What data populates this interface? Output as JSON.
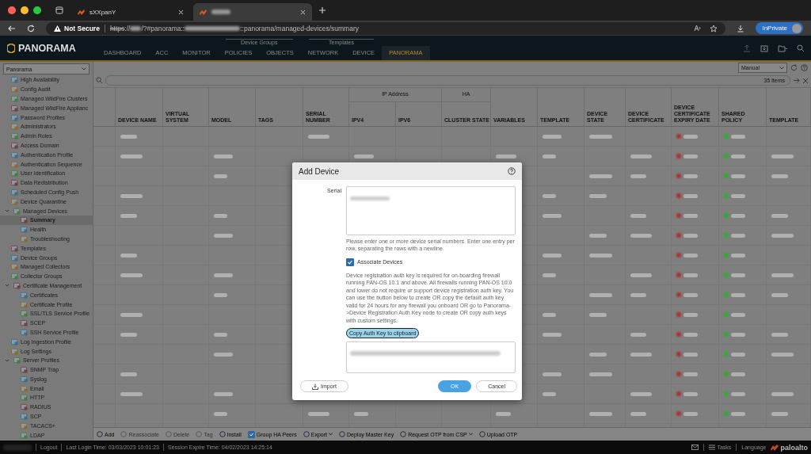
{
  "browser": {
    "tabs": [
      {
        "title": "sXXpanY",
        "selected": false
      },
      {
        "selected": true
      }
    ],
    "address": {
      "security": "Not Secure",
      "scheme": "https",
      "url_parts": [
        "://",
        "/?#panorama::",
        "::panorama/managed-devices/summary"
      ]
    },
    "profile": "InPrivate"
  },
  "app_header": {
    "logo": "PANORAMA",
    "nav": [
      {
        "items": [
          {
            "label": "DASHBOARD",
            "selected": false
          },
          {
            "label": "ACC",
            "selected": false
          },
          {
            "label": "MONITOR",
            "selected": false
          }
        ]
      },
      {
        "group": "Device Groups",
        "items": [
          {
            "label": "POLICIES",
            "selected": false
          },
          {
            "label": "OBJECTS",
            "selected": false
          }
        ]
      },
      {
        "group": "Templates",
        "items": [
          {
            "label": "NETWORK",
            "selected": false
          },
          {
            "label": "DEVICE",
            "selected": false
          }
        ]
      },
      {
        "items": [
          {
            "label": "PANORAMA",
            "selected": true
          }
        ]
      }
    ]
  },
  "sidebar": {
    "context": "Panorama",
    "items": [
      {
        "label": "High Availability",
        "selected": false
      },
      {
        "label": "Config Audit",
        "selected": false
      },
      {
        "label": "Managed WildFire Clusters",
        "selected": false
      },
      {
        "label": "Managed WildFire Applianc",
        "selected": false
      },
      {
        "label": "Password Profiles",
        "selected": false
      },
      {
        "label": "Administrators",
        "selected": false
      },
      {
        "label": "Admin Roles",
        "selected": false
      },
      {
        "label": "Access Domain",
        "selected": false
      },
      {
        "label": "Authentication Profile",
        "selected": false
      },
      {
        "label": "Authentication Sequence",
        "selected": false
      },
      {
        "label": "User Identification",
        "selected": false
      },
      {
        "label": "Data Redistribution",
        "selected": false
      },
      {
        "label": "Scheduled Config Push",
        "selected": false
      },
      {
        "label": "Device Quarantine",
        "selected": false
      },
      {
        "label": "Managed Devices",
        "selected": false,
        "expanded": true,
        "children": [
          {
            "label": "Summary",
            "selected": true
          },
          {
            "label": "Health",
            "selected": false
          },
          {
            "label": "Troubleshooting",
            "selected": false
          }
        ]
      },
      {
        "label": "Templates",
        "selected": false
      },
      {
        "label": "Device Groups",
        "selected": false
      },
      {
        "label": "Managed Collectors",
        "selected": false
      },
      {
        "label": "Collector Groups",
        "selected": false
      },
      {
        "label": "Certificate Management",
        "selected": false,
        "expanded": true,
        "children": [
          {
            "label": "Certificates",
            "selected": false
          },
          {
            "label": "Certificate Profile",
            "selected": false
          },
          {
            "label": "SSL/TLS Service Profile",
            "selected": false
          },
          {
            "label": "SCEP",
            "selected": false
          },
          {
            "label": "SSH Service Profile",
            "selected": false
          }
        ]
      },
      {
        "label": "Log Ingestion Profile",
        "selected": false
      },
      {
        "label": "Log Settings",
        "selected": false
      },
      {
        "label": "Server Profiles",
        "selected": false,
        "expanded": true,
        "children": [
          {
            "label": "SNMP Trap",
            "selected": false
          },
          {
            "label": "Syslog",
            "selected": false
          },
          {
            "label": "Email",
            "selected": false
          },
          {
            "label": "HTTP",
            "selected": false
          },
          {
            "label": "RADIUS",
            "selected": false
          },
          {
            "label": "SCP",
            "selected": false
          },
          {
            "label": "TACACS+",
            "selected": false
          },
          {
            "label": "LDAP",
            "selected": false
          }
        ]
      }
    ]
  },
  "toolbar": {
    "refresh_mode": "Manual",
    "item_count": "35 items"
  },
  "table": {
    "columns": [
      {
        "label": "DEVICE NAME"
      },
      {
        "label": "VIRTUAL SYSTEM"
      },
      {
        "label": "MODEL"
      },
      {
        "label": "TAGS"
      },
      {
        "label": "SERIAL NUMBER"
      },
      {
        "group": "IP Address",
        "children": [
          {
            "label": "IPV4"
          },
          {
            "label": "IPV6"
          }
        ]
      },
      {
        "group": "HA",
        "children": [
          {
            "label": "CLUSTER STATE"
          }
        ]
      },
      {
        "label": "VARIABLES"
      },
      {
        "label": "TEMPLATE"
      },
      {
        "label": "DEVICE STATE"
      },
      {
        "label": "DEVICE CERTIFICATE"
      },
      {
        "label": "DEVICE CERTIFICATE EXPIRY DATE"
      },
      {
        "label": "SHARED POLICY"
      },
      {
        "label": "TEMPLATE"
      }
    ]
  },
  "actions": [
    {
      "kind": "button",
      "label": "Add",
      "disabled": false,
      "dropdown": false
    },
    {
      "kind": "button",
      "label": "Reassociate",
      "disabled": true,
      "dropdown": false
    },
    {
      "kind": "button",
      "label": "Delete",
      "disabled": true,
      "dropdown": false
    },
    {
      "kind": "button",
      "label": "Tag",
      "disabled": true,
      "dropdown": false
    },
    {
      "kind": "button",
      "label": "Install",
      "disabled": false,
      "dropdown": false
    },
    {
      "kind": "checkbox",
      "label": "Group HA Peers",
      "checked": true
    },
    {
      "kind": "button",
      "label": "Export",
      "disabled": false,
      "dropdown": true
    },
    {
      "kind": "button",
      "label": "Deploy Master Key",
      "disabled": false,
      "dropdown": false
    },
    {
      "kind": "button",
      "label": "Request OTP from CSP",
      "disabled": false,
      "dropdown": true
    },
    {
      "kind": "button",
      "label": "Upload OTP",
      "disabled": false,
      "dropdown": false
    }
  ],
  "status_bar": {
    "logout": "Logout",
    "last_login": "Last Login Time: 03/03/2023 10:01:23",
    "session_expire": "Session Expire Time: 04/02/2023 14:25:14",
    "tasks": "Tasks",
    "language": "Language",
    "brand": "paloalto"
  },
  "dialog": {
    "title": "Add Device",
    "serial_label": "Serial",
    "serial_hint": "Please enter one or more device serial numbers. Enter one entry per row, separating the rows with a newline.",
    "associate": {
      "label": "Associate Devices",
      "checked": true
    },
    "description": "Device registration auth key is required for on-boarding firewall running PAN-OS 10.1 and above. All firewalls running PAN-OS 10.0 and lower do not require or support device registration auth key. You can use the button below to create OR copy the default auth key valid for 24 hours for any firewall you onboard OR go to Panorama->Device Registration Auth Key node to create OR copy auth keys with custom settings.",
    "copy_button": "Copy Auth Key to clipboard",
    "import_button": "Import",
    "ok_button": "OK",
    "cancel_button": "Cancel"
  }
}
